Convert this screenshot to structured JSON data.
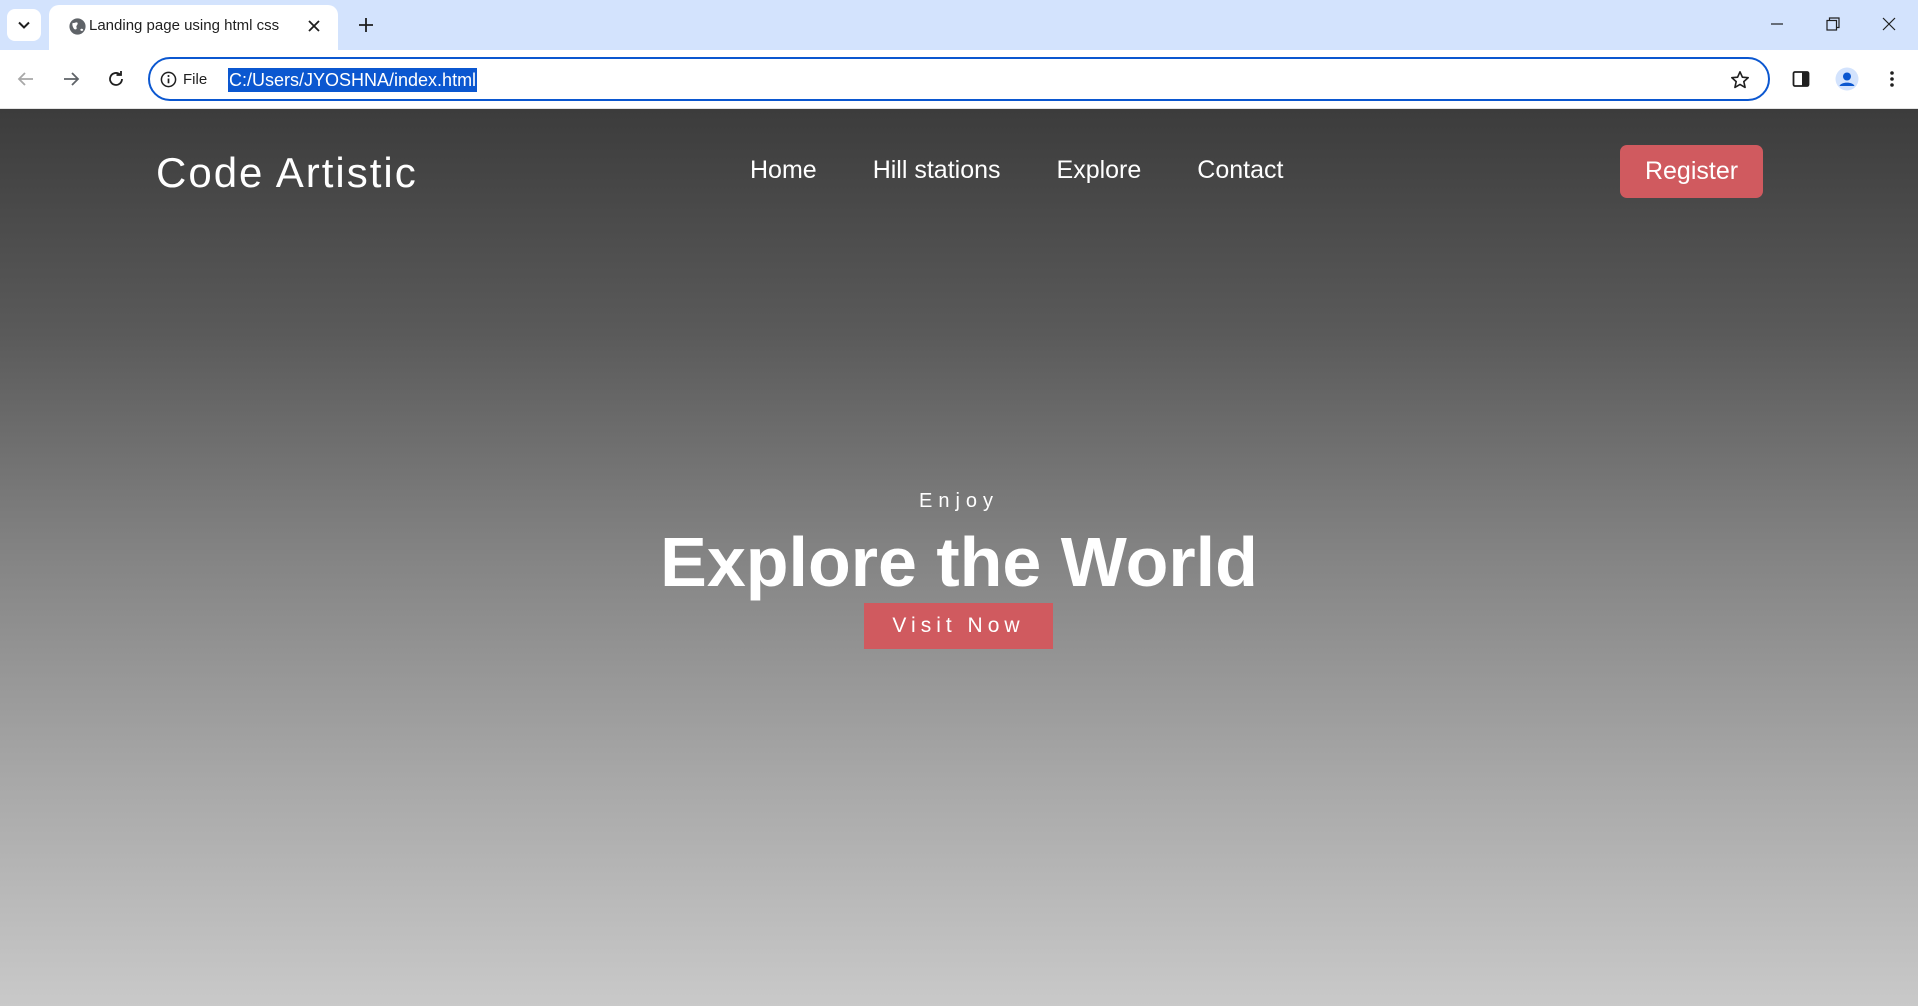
{
  "browser": {
    "tab_title": "Landing page using html css",
    "address": {
      "scheme_label": "File",
      "url": "C:/Users/JYOSHNA/index.html"
    }
  },
  "site": {
    "logo": "Code Artistic",
    "nav": [
      "Home",
      "Hill stations",
      "Explore",
      "Contact"
    ],
    "register_label": "Register",
    "hero": {
      "eyebrow": "Enjoy",
      "title": "Explore the World",
      "cta_label": "Visit Now"
    }
  },
  "colors": {
    "accent": "#d05a5f",
    "chrome_tabstrip": "#d3e3fd",
    "omnibox_focus": "#0b57d0"
  }
}
